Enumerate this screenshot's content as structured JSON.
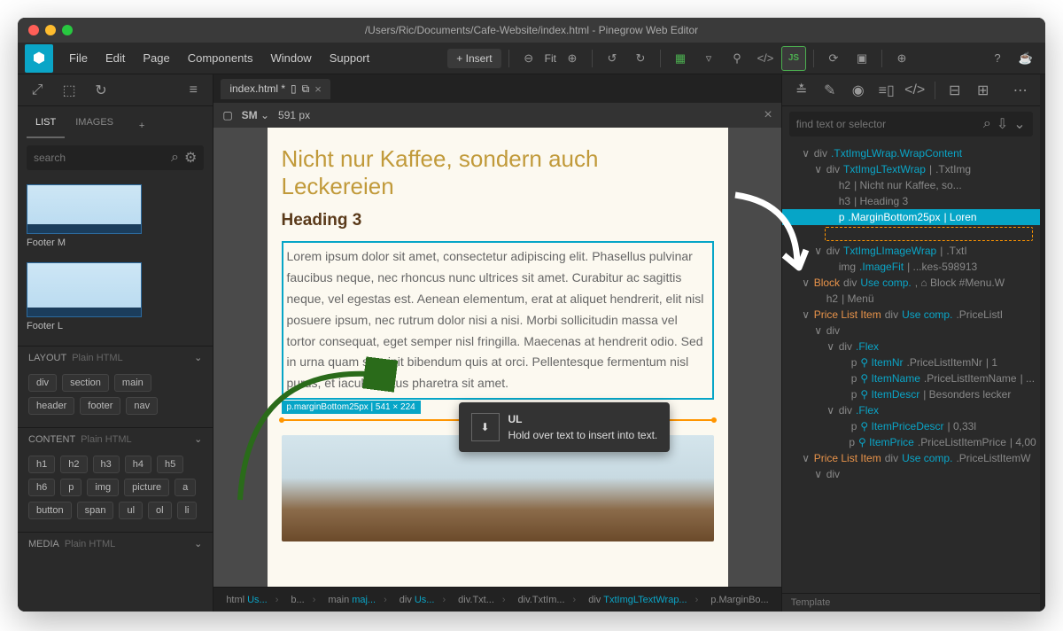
{
  "titlebar": {
    "path": "/Users/Ric/Documents/Cafe-Website/index.html - Pinegrow Web Editor"
  },
  "menu": {
    "file": "File",
    "edit": "Edit",
    "page": "Page",
    "components": "Components",
    "window": "Window",
    "support": "Support",
    "insert": "+ Insert",
    "fit": "Fit"
  },
  "left": {
    "tab_list": "LIST",
    "tab_images": "IMAGES",
    "search_ph": "search",
    "thumbs": [
      {
        "label": "Footer M"
      },
      {
        "label": "Footer L"
      }
    ],
    "sec_layout": "LAYOUT",
    "sec_content": "CONTENT",
    "sec_media": "MEDIA",
    "sub": "Plain HTML",
    "layout_chips": [
      "div",
      "section",
      "main",
      "header",
      "footer",
      "nav"
    ],
    "content_chips": [
      "h1",
      "h2",
      "h3",
      "h4",
      "h5",
      "h6",
      "p",
      "img",
      "picture",
      "a",
      "button",
      "span",
      "ul",
      "ol",
      "li"
    ]
  },
  "center": {
    "tab": "index.html *",
    "viewport_label": "SM",
    "viewport_px": "591 px",
    "h2": "Nicht nur Kaffee, sondern auch Leckereien",
    "h3": "Heading 3",
    "para": "Lorem ipsum dolor sit amet, consectetur adipiscing elit. Phasellus pulvinar faucibus neque, nec rhoncus nunc ultrices sit amet. Curabitur ac sagittis neque, vel egestas est. Aenean elementum, erat at aliquet hendrerit, elit nisl posuere ipsum, nec rutrum dolor nisi a nisi. Morbi sollicitudin massa vel tortor consequat, eget semper nisl fringilla. Maecenas at hendrerit odio. Sed in urna quam suscipit bibendum quis at orci. Pellentesque fermentum nisl purus, et iaculis lectus pharetra sit amet.",
    "sel_label": "p.marginBottom25px | 541 × 224",
    "ul_chip": "ul",
    "tooltip_title": "UL",
    "tooltip_body": "Hold over text to insert into text.",
    "crumbs": [
      {
        "t": "html",
        "c": "Us..."
      },
      {
        "t": "b..."
      },
      {
        "t": "main",
        "c": "maj..."
      },
      {
        "t": "div",
        "c": "Us..."
      },
      {
        "t": "div.Txt..."
      },
      {
        "t": "div.TxtIm..."
      },
      {
        "t": "div",
        "c": "TxtImgLTextWrap..."
      },
      {
        "t": "p.MarginBo..."
      }
    ]
  },
  "right": {
    "filter_ph": "find text or selector",
    "tree": [
      {
        "i": 1,
        "caret": "∨",
        "t": "div",
        "cls": ".TxtImgLWrap.WrapContent"
      },
      {
        "i": 2,
        "caret": "∨",
        "t": "div",
        "pipe": "|",
        "cls": "TxtImgLTextWrap",
        "ext": ".TxtImg"
      },
      {
        "i": 3,
        "t": "h2",
        "txt": "| Nicht nur Kaffee, so..."
      },
      {
        "i": 3,
        "t": "h3",
        "txt": "| Heading 3"
      },
      {
        "i": 3,
        "sel": true,
        "t": "p",
        "cls": ".MarginBottom25px",
        "txt": "| Loren"
      },
      {
        "drop": true
      },
      {
        "i": 2,
        "caret": "∨",
        "t": "div",
        "pipe": "|",
        "cls": "TxtImgLImageWrap",
        "ext": ".TxtI"
      },
      {
        "i": 3,
        "t": "img",
        "cls": ".ImageFit",
        "txt": "| ...kes-598913"
      },
      {
        "i": 1,
        "caret": "∨",
        "orange": "Block",
        "t": "div",
        "blue": "Use comp.",
        "after": ", ⌂ Block #Menu.W"
      },
      {
        "i": 2,
        "t": "h2",
        "txt": "| Menü"
      },
      {
        "i": 1,
        "caret": "∨",
        "orange": "Price List Item",
        "t": "div",
        "blue": "Use comp.",
        "ext": ".PriceListI"
      },
      {
        "i": 2,
        "caret": "∨",
        "t": "div"
      },
      {
        "i": 3,
        "caret": "∨",
        "t": "div",
        "cls": ".Flex"
      },
      {
        "i": 4,
        "t": "p",
        "lk": "ItemNr",
        "ext": ".PriceListItemNr",
        "txt": "| 1"
      },
      {
        "i": 4,
        "t": "p",
        "lk": "ItemName",
        "ext": ".PriceListItemName",
        "txt": "| ..."
      },
      {
        "i": 4,
        "t": "p",
        "lk": "ItemDescr",
        "txt": "| Besonders lecker"
      },
      {
        "i": 3,
        "caret": "∨",
        "t": "div",
        "cls": ".Flex"
      },
      {
        "i": 4,
        "t": "p",
        "lk": "ItemPriceDescr",
        "txt": "| 0,33l"
      },
      {
        "i": 4,
        "t": "p",
        "lk": "ItemPrice",
        "ext": ".PriceListItemPrice",
        "txt": "| 4,00"
      },
      {
        "i": 1,
        "caret": "∨",
        "orange": "Price List Item",
        "t": "div",
        "blue": "Use comp.",
        "ext": ".PriceListItemW"
      },
      {
        "i": 2,
        "caret": "∨",
        "t": "div"
      }
    ],
    "template": "Template"
  }
}
